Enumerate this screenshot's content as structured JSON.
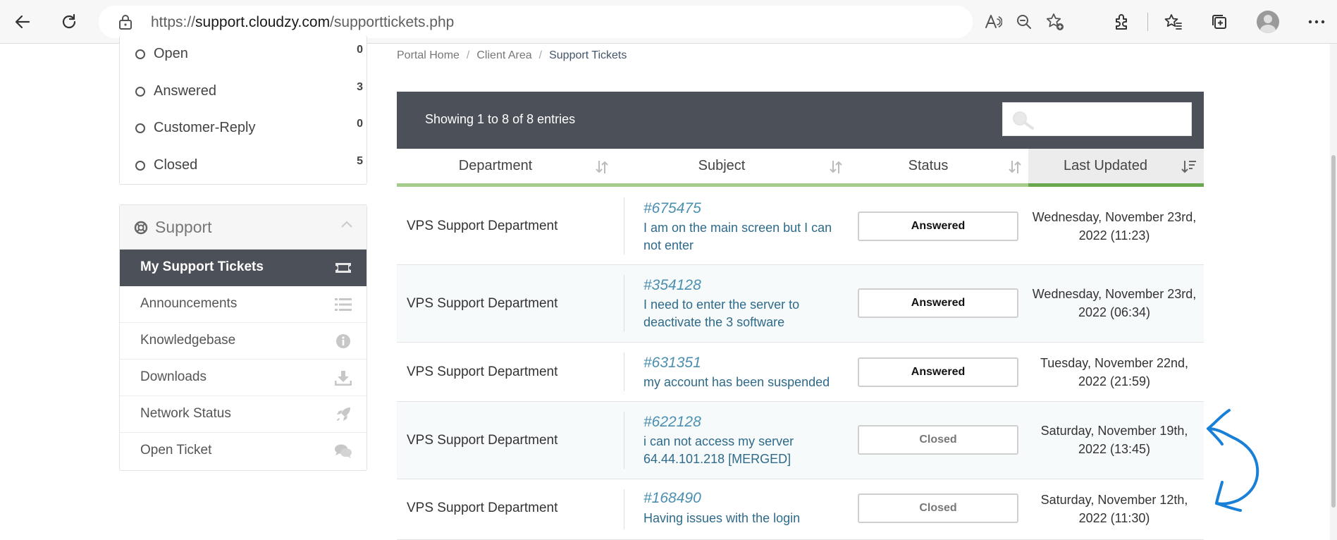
{
  "browser": {
    "url_prefix": "https://",
    "url_host": "support.cloudzy.com",
    "url_path": "/supporttickets.php"
  },
  "sidebar": {
    "filters": [
      {
        "label": "Open",
        "count": "0"
      },
      {
        "label": "Answered",
        "count": "3"
      },
      {
        "label": "Customer-Reply",
        "count": "0"
      },
      {
        "label": "Closed",
        "count": "5"
      }
    ],
    "support": {
      "title": "Support",
      "items": [
        {
          "label": "My Support Tickets",
          "icon": "ticket-icon",
          "active": true
        },
        {
          "label": "Announcements",
          "icon": "list-icon"
        },
        {
          "label": "Knowledgebase",
          "icon": "info-icon"
        },
        {
          "label": "Downloads",
          "icon": "download-icon"
        },
        {
          "label": "Network Status",
          "icon": "rocket-icon"
        },
        {
          "label": "Open Ticket",
          "icon": "comments-icon"
        }
      ]
    }
  },
  "breadcrumb": {
    "items": [
      "Portal Home",
      "Client Area",
      "Support Tickets"
    ]
  },
  "table": {
    "entries_text": "Showing 1 to 8 of 8 entries",
    "search_value": "",
    "columns": [
      "Department",
      "Subject",
      "Status",
      "Last Updated"
    ],
    "rows": [
      {
        "department": "VPS Support Department",
        "ticket_id": "#675475",
        "subject": "I am on the main screen but I can not enter",
        "status": "Answered",
        "updated": "Wednesday, November 23rd, 2022 (11:23)"
      },
      {
        "department": "VPS Support Department",
        "ticket_id": "#354128",
        "subject": "I need to enter the server to deactivate the 3 software",
        "status": "Answered",
        "updated": "Wednesday, November 23rd, 2022 (06:34)"
      },
      {
        "department": "VPS Support Department",
        "ticket_id": "#631351",
        "subject": "my account has been suspended",
        "status": "Answered",
        "updated": "Tuesday, November 22nd, 2022 (21:59)"
      },
      {
        "department": "VPS Support Department",
        "ticket_id": "#622128",
        "subject": "i can not access my server 64.44.101.218 [MERGED]",
        "status": "Closed",
        "updated": "Saturday, November 19th, 2022 (13:45)"
      },
      {
        "department": "VPS Support Department",
        "ticket_id": "#168490",
        "subject": "Having issues with the login",
        "status": "Closed",
        "updated": "Saturday, November 12th, 2022 (11:30)"
      }
    ]
  },
  "colors": {
    "header_bg": "#4c5058",
    "accent_green": "#a6cc8b",
    "link_blue": "#4b8fb0",
    "annotation_blue": "#1a7fd6"
  }
}
